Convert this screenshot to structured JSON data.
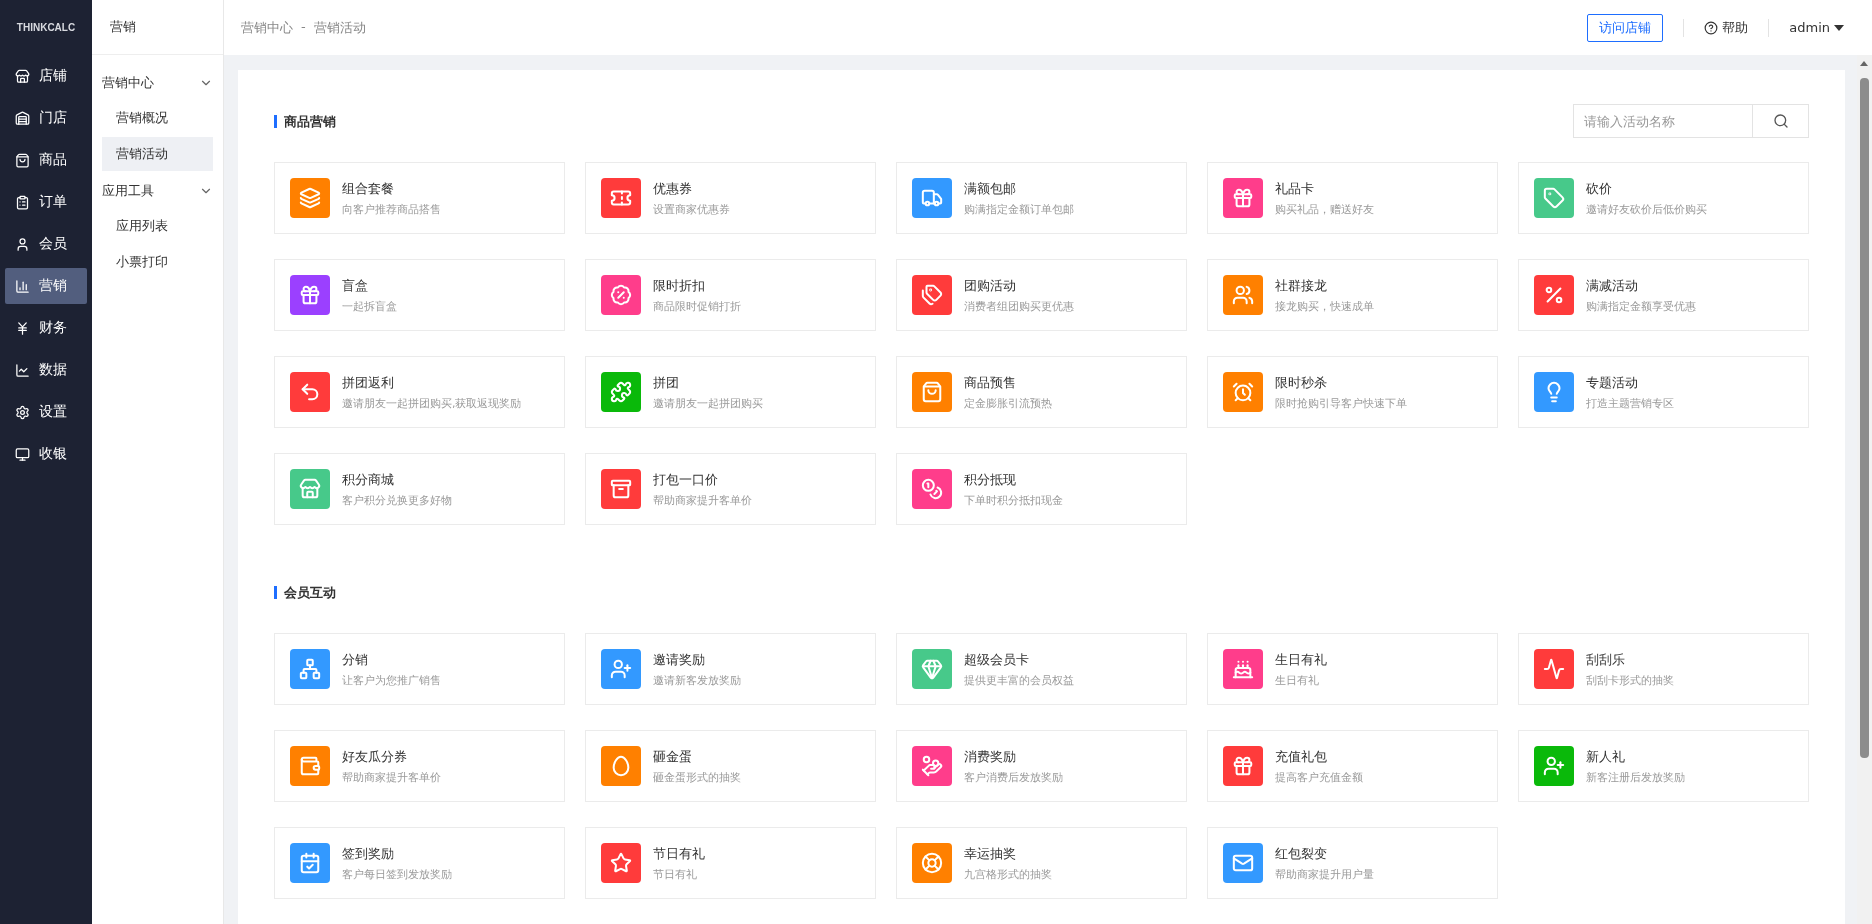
{
  "brand": "THINKCALC",
  "nav": [
    {
      "label": "店铺",
      "selected": false
    },
    {
      "label": "门店",
      "selected": false
    },
    {
      "label": "商品",
      "selected": false
    },
    {
      "label": "订单",
      "selected": false
    },
    {
      "label": "会员",
      "selected": false
    },
    {
      "label": "营销",
      "selected": true
    },
    {
      "label": "财务",
      "selected": false
    },
    {
      "label": "数据",
      "selected": false
    },
    {
      "label": "设置",
      "selected": false
    },
    {
      "label": "收银",
      "selected": false
    }
  ],
  "submenu": {
    "title": "营销",
    "groups": [
      {
        "label": "营销中心",
        "expanded": true,
        "children": [
          {
            "label": "营销概况",
            "selected": false
          },
          {
            "label": "营销活动",
            "selected": true
          }
        ]
      },
      {
        "label": "应用工具",
        "expanded": true,
        "children": [
          {
            "label": "应用列表",
            "selected": false
          },
          {
            "label": "小票打印",
            "selected": false
          }
        ]
      }
    ]
  },
  "breadcrumb": [
    "营销中心",
    "营销活动"
  ],
  "breadcrumb_separator": "-",
  "header": {
    "visit_button": "访问店铺",
    "help": "帮助",
    "user": "admin"
  },
  "search": {
    "placeholder": "请输入活动名称"
  },
  "sections": [
    {
      "title": "商品营销",
      "items": [
        {
          "title": "组合套餐",
          "desc": "向客户推荐商品搭售",
          "color": "#ff8000"
        },
        {
          "title": "优惠券",
          "desc": "设置商家优惠券",
          "color": "#ff3b3b"
        },
        {
          "title": "满额包邮",
          "desc": "购满指定金额订单包邮",
          "color": "#3399ff"
        },
        {
          "title": "礼品卡",
          "desc": "购买礼品，赠送好友",
          "color": "#ff3d8b"
        },
        {
          "title": "砍价",
          "desc": "邀请好友砍价后低价购买",
          "color": "#47c98a"
        },
        {
          "title": "盲盒",
          "desc": "一起拆盲盒",
          "color": "#9b40ff"
        },
        {
          "title": "限时折扣",
          "desc": "商品限时促销打折",
          "color": "#ff3d8b"
        },
        {
          "title": "团购活动",
          "desc": "消费者组团购买更优惠",
          "color": "#ff3b3b"
        },
        {
          "title": "社群接龙",
          "desc": "接龙购买，快速成单",
          "color": "#ff8000"
        },
        {
          "title": "满减活动",
          "desc": "购满指定金额享受优惠",
          "color": "#ff3b3b"
        },
        {
          "title": "拼团返利",
          "desc": "邀请朋友一起拼团购买,获取返现奖励",
          "color": "#ff3b3b"
        },
        {
          "title": "拼团",
          "desc": "邀请朋友一起拼团购买",
          "color": "#0ab90a"
        },
        {
          "title": "商品预售",
          "desc": "定金膨胀引流预热",
          "color": "#ff8000"
        },
        {
          "title": "限时秒杀",
          "desc": "限时抢购引导客户快速下单",
          "color": "#ff8000"
        },
        {
          "title": "专题活动",
          "desc": "打造主题营销专区",
          "color": "#3399ff"
        },
        {
          "title": "积分商城",
          "desc": "客户积分兑换更多好物",
          "color": "#47c98a"
        },
        {
          "title": "打包一口价",
          "desc": "帮助商家提升客单价",
          "color": "#ff3b3b"
        },
        {
          "title": "积分抵现",
          "desc": "下单时积分抵扣现金",
          "color": "#ff3d8b"
        }
      ]
    },
    {
      "title": "会员互动",
      "items": [
        {
          "title": "分销",
          "desc": "让客户为您推广销售",
          "color": "#3399ff"
        },
        {
          "title": "邀请奖励",
          "desc": "邀请新客发放奖励",
          "color": "#3399ff"
        },
        {
          "title": "超级会员卡",
          "desc": "提供更丰富的会员权益",
          "color": "#47c98a"
        },
        {
          "title": "生日有礼",
          "desc": "生日有礼",
          "color": "#ff3d8b"
        },
        {
          "title": "刮刮乐",
          "desc": "刮刮卡形式的抽奖",
          "color": "#ff3b3b"
        },
        {
          "title": "好友瓜分券",
          "desc": "帮助商家提升客单价",
          "color": "#ff8000"
        },
        {
          "title": "砸金蛋",
          "desc": "砸金蛋形式的抽奖",
          "color": "#ff8000"
        },
        {
          "title": "消费奖励",
          "desc": "客户消费后发放奖励",
          "color": "#ff3d8b"
        },
        {
          "title": "充值礼包",
          "desc": "提高客户充值金额",
          "color": "#ff3b3b"
        },
        {
          "title": "新人礼",
          "desc": "新客注册后发放奖励",
          "color": "#0ab90a"
        },
        {
          "title": "签到奖励",
          "desc": "客户每日签到发放奖励",
          "color": "#3399ff"
        },
        {
          "title": "节日有礼",
          "desc": "节日有礼",
          "color": "#ff3b3b"
        },
        {
          "title": "幸运抽奖",
          "desc": "九宫格形式的抽奖",
          "color": "#ff8000"
        },
        {
          "title": "红包裂变",
          "desc": "帮助商家提升用户量",
          "color": "#3399ff"
        }
      ]
    }
  ]
}
